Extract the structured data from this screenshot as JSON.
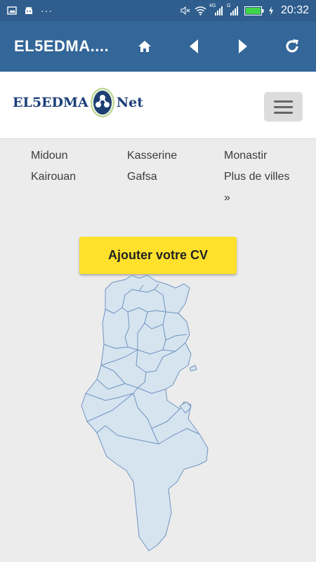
{
  "status_bar": {
    "time": "20:32",
    "network_4g": "4G",
    "network_g": "G",
    "icons": [
      "image-icon",
      "android-icon",
      "more-dots-icon",
      "mute-icon",
      "wifi-icon",
      "signal-icon",
      "signal-icon-2",
      "battery-icon",
      "charging-icon"
    ]
  },
  "app_bar": {
    "title": "EL5EDMA....",
    "buttons": [
      "home-icon",
      "back-icon",
      "forward-icon",
      "refresh-icon"
    ],
    "color": "#336699"
  },
  "site": {
    "logo_left": "EL5EDMA",
    "logo_right": "Net",
    "menu_icon": "hamburger-icon"
  },
  "cities": [
    [
      "Midoun",
      "Kasserine",
      "Monastir"
    ],
    [
      "Kairouan",
      "Gafsa",
      "Plus de villes"
    ]
  ],
  "more_arrow": "»",
  "cv_button": {
    "label": "Ajouter votre CV",
    "color": "#ffe12c"
  },
  "map": {
    "fill": "#d6e4f0",
    "stroke": "#6f93bf"
  }
}
